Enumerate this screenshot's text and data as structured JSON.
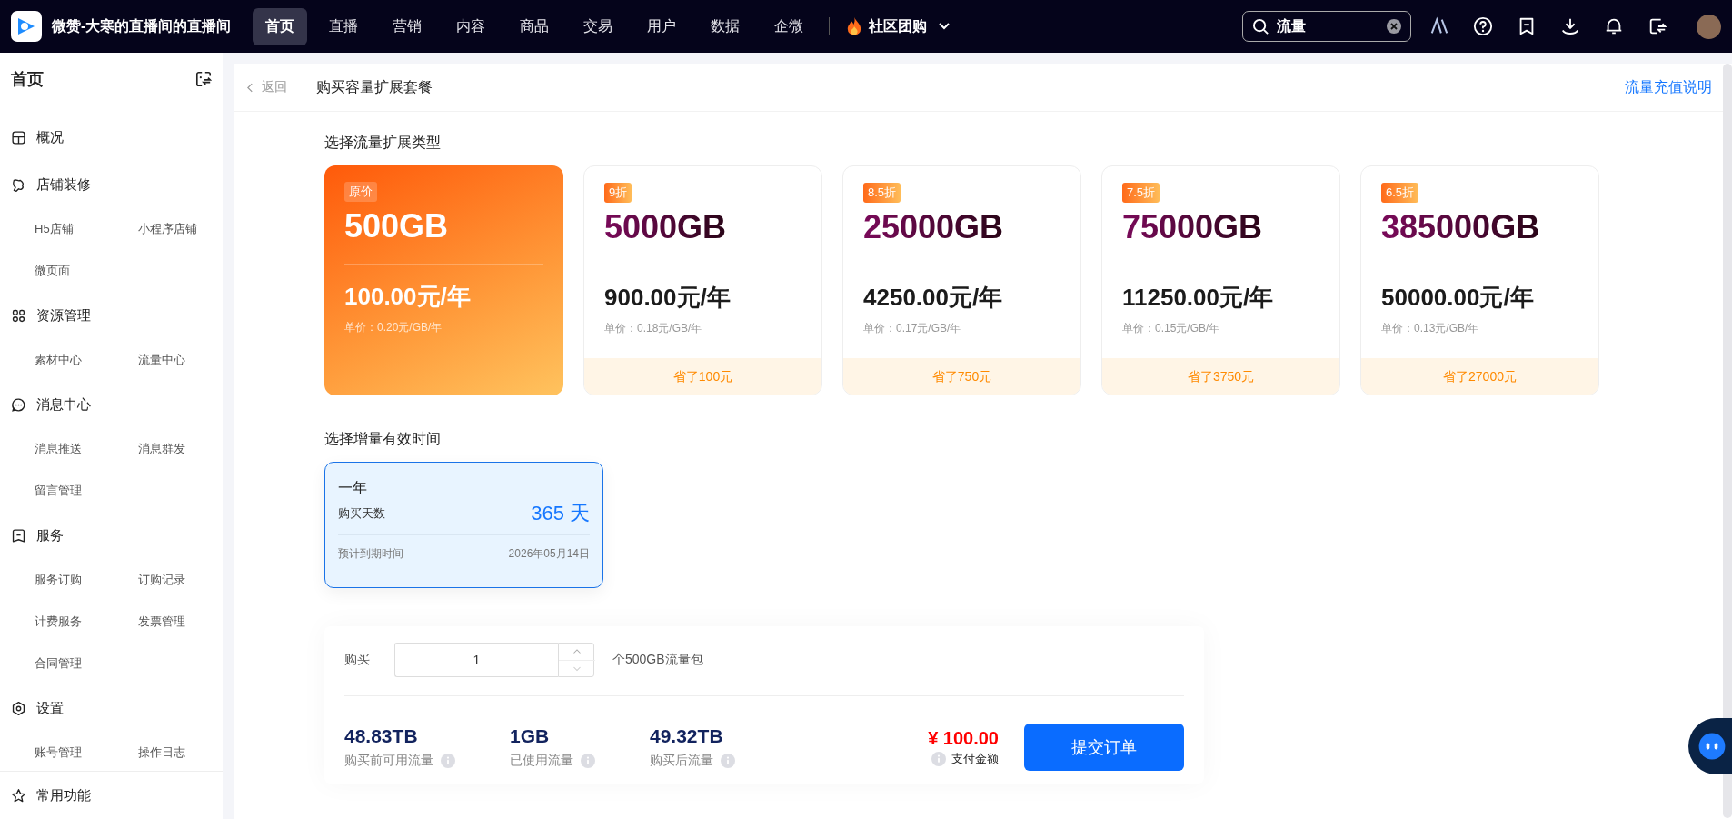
{
  "topbar": {
    "app_name": "微赞-大寒的直播间的直播间",
    "nav": [
      {
        "label": "首页",
        "selected": true
      },
      {
        "label": "直播",
        "selected": false
      },
      {
        "label": "营销",
        "selected": false
      },
      {
        "label": "内容",
        "selected": false
      },
      {
        "label": "商品",
        "selected": false
      },
      {
        "label": "交易",
        "selected": false
      },
      {
        "label": "用户",
        "selected": false
      },
      {
        "label": "数据",
        "selected": false
      },
      {
        "label": "企微",
        "selected": false
      }
    ],
    "featured": "社区团购",
    "search": {
      "value": "流量"
    }
  },
  "sidebar": {
    "title": "首页",
    "sections": [
      {
        "label": "概况"
      },
      {
        "label": "店铺装修",
        "items": [
          "H5店铺",
          "小程序店铺",
          "微页面"
        ]
      },
      {
        "label": "资源管理",
        "items": [
          "素材中心",
          "流量中心"
        ]
      },
      {
        "label": "消息中心",
        "items": [
          "消息推送",
          "消息群发",
          "留言管理"
        ]
      },
      {
        "label": "服务",
        "items": [
          "服务订购",
          "订购记录",
          "计费服务",
          "发票管理",
          "合同管理"
        ]
      },
      {
        "label": "设置",
        "items": [
          "账号管理",
          "操作日志"
        ]
      }
    ],
    "footer": "常用功能"
  },
  "page": {
    "back": "返回",
    "title": "购买容量扩展套餐",
    "help_link": "流量充值说明",
    "package_heading": "选择流量扩展类型",
    "packages": [
      {
        "badge": "原价",
        "amount": "500GB",
        "price": "100.00元/年",
        "unit_price": "单价：0.20元/GB/年",
        "selected": true
      },
      {
        "badge": "9折",
        "amount": "5000GB",
        "price": "900.00元/年",
        "unit_price": "单价：0.18元/GB/年",
        "saving": "省了100元",
        "selected": false
      },
      {
        "badge": "8.5折",
        "amount": "25000GB",
        "price": "4250.00元/年",
        "unit_price": "单价：0.17元/GB/年",
        "saving": "省了750元",
        "selected": false
      },
      {
        "badge": "7.5折",
        "amount": "75000GB",
        "price": "11250.00元/年",
        "unit_price": "单价：0.15元/GB/年",
        "saving": "省了3750元",
        "selected": false
      },
      {
        "badge": "6.5折",
        "amount": "385000GB",
        "price": "50000.00元/年",
        "unit_price": "单价：0.13元/GB/年",
        "saving": "省了27000元",
        "selected": false
      }
    ],
    "duration_heading": "选择增量有效时间",
    "durations": [
      {
        "name": "一年",
        "days_label": "购买天数",
        "days": "365 天",
        "expiry_label": "预计到期时间",
        "expiry": "2026年05月14日",
        "selected": true
      }
    ],
    "order": {
      "buy_label": "购买",
      "quantity": "1",
      "unit": "个500GB流量包",
      "stats": [
        {
          "value": "48.83TB",
          "label": "购买前可用流量"
        },
        {
          "value": "1GB",
          "label": "已使用流量"
        },
        {
          "value": "49.32TB",
          "label": "购买后流量"
        }
      ],
      "total": "¥ 100.00",
      "total_label": "支付金额",
      "submit": "提交订单"
    }
  }
}
